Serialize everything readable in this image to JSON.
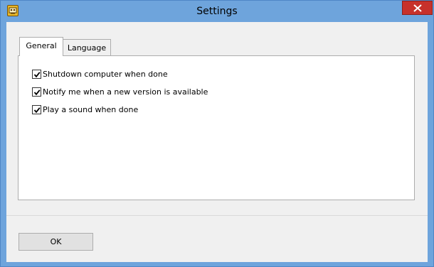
{
  "window": {
    "title": "Settings",
    "app_icon": "app-icon",
    "close_icon": "close-icon"
  },
  "tabs": [
    {
      "label": "General",
      "active": true
    },
    {
      "label": "Language",
      "active": false
    }
  ],
  "general": {
    "options": [
      {
        "label": "Shutdown computer when done",
        "checked": true
      },
      {
        "label": "Notify me when a new version is available",
        "checked": true
      },
      {
        "label": "Play a sound when done",
        "checked": true
      }
    ]
  },
  "footer": {
    "ok_label": "OK"
  },
  "colors": {
    "titlebar": "#6ea4dc",
    "close_button": "#c7312b",
    "dialog_background": "#f0f0f0",
    "panel_background": "#ffffff"
  }
}
